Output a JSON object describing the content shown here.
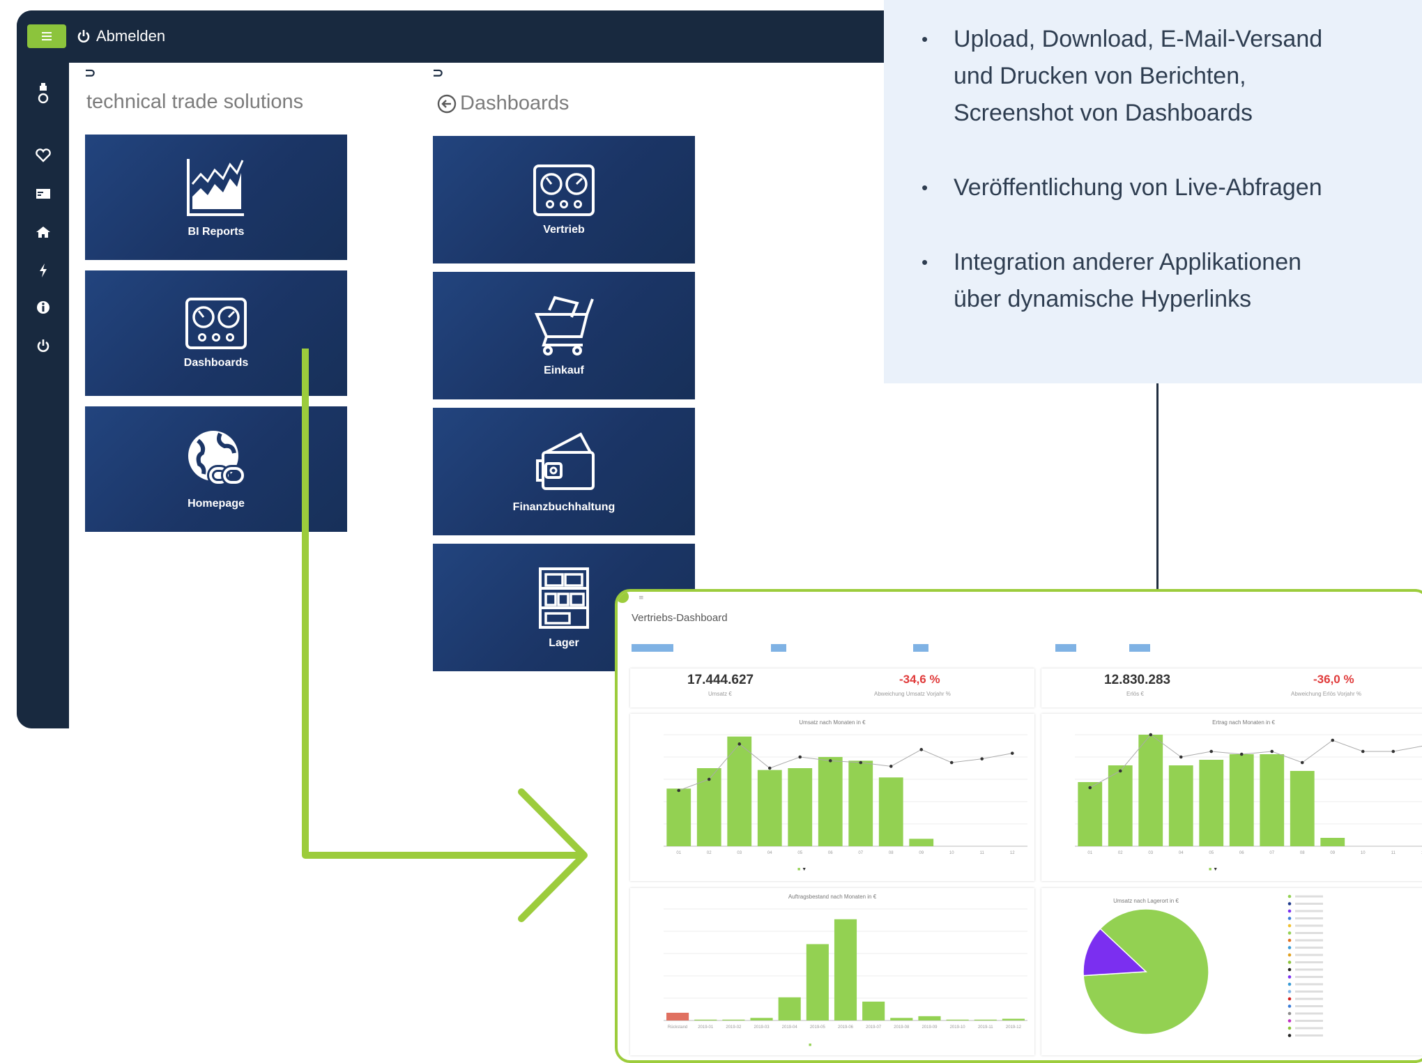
{
  "topbar": {
    "logout_label": "Abmelden"
  },
  "sidebar": {
    "icons": [
      "user-icon",
      "heart-icon",
      "card-icon",
      "home-icon",
      "bolt-icon",
      "info-icon",
      "power-icon"
    ]
  },
  "columns": [
    {
      "title": "technical trade solutions",
      "tiles": [
        "BI Reports",
        "Dashboards",
        "Homepage"
      ]
    },
    {
      "title": "Dashboards",
      "tiles": [
        "Vertrieb",
        "Einkauf",
        "Finanzbuchhaltung",
        "Lager"
      ]
    }
  ],
  "info": {
    "items": [
      {
        "lines": [
          "Upload, Download, E-Mail-Versand",
          "und Drucken von Berichten,",
          "Screenshot von Dashboards"
        ]
      },
      {
        "lines": [
          "Veröffentlichung von Live-Abfragen"
        ]
      },
      {
        "lines": [
          "Integration anderer Applikationen",
          "über dynamische Hyperlinks"
        ]
      }
    ]
  },
  "colors": {
    "navy": "#18293f",
    "accent_green": "#8cc43c",
    "tile_blue": "#1b3566",
    "bar_green": "#93d152",
    "negative": "#e03a3a",
    "pie_purple": "#7b2ff0"
  },
  "dashboard": {
    "title": "Vertriebs-Dashboard",
    "kpis": [
      {
        "value": "17.444.627",
        "label": "Umsatz €"
      },
      {
        "value": "-34,6 %",
        "label": "Abweichung Umsatz Vorjahr %"
      },
      {
        "value": "12.830.283",
        "label": "Erlös €"
      },
      {
        "value": "-36,0 %",
        "label": "Abweichung Erlös Vorjahr %"
      }
    ],
    "charts": [
      {
        "title": "Umsatz nach Monaten in €"
      },
      {
        "title": "Ertrag nach Monaten in €"
      },
      {
        "title": "Auftragsbestand nach Monaten in €"
      },
      {
        "title": "Umsatz nach Lagerort in €"
      }
    ]
  },
  "chart_data": [
    {
      "type": "bar",
      "title": "Umsatz nach Monaten in €",
      "categories": [
        "01",
        "02",
        "03",
        "04",
        "05",
        "06",
        "07",
        "08",
        "09",
        "10",
        "11",
        "12"
      ],
      "series": [
        {
          "values": [
            1550000,
            2100000,
            2950000,
            2050000,
            2100000,
            2400000,
            2300000,
            1850000,
            200000,
            0,
            0,
            0
          ]
        },
        {
          "values": [
            1500000,
            1800000,
            2750000,
            2100000,
            2400000,
            2300000,
            2250000,
            2150000,
            2600000,
            2250000,
            2350000,
            2500000
          ]
        }
      ],
      "ylim": [
        0,
        3000000
      ]
    },
    {
      "type": "bar",
      "title": "Ertrag nach Monaten in €",
      "categories": [
        "01",
        "02",
        "03",
        "04",
        "05",
        "06",
        "07",
        "08",
        "09",
        "10",
        "11",
        "12"
      ],
      "series": [
        {
          "values": [
            1150000,
            1450000,
            2000000,
            1450000,
            1550000,
            1650000,
            1650000,
            1350000,
            150000,
            0,
            0,
            0
          ]
        },
        {
          "values": [
            1050000,
            1350000,
            2000000,
            1600000,
            1700000,
            1650000,
            1700000,
            1500000,
            1900000,
            1700000,
            1700000,
            1800000
          ]
        }
      ],
      "ylim": [
        0,
        2000000
      ]
    },
    {
      "type": "bar",
      "title": "Auftragsbestand nach Monaten in €",
      "categories": [
        "Rückstand",
        "2019-01",
        "2019-02",
        "2019-03",
        "2019-04",
        "2019-05",
        "2019-06",
        "2019-07",
        "2019-08",
        "2019-09",
        "2019-10",
        "2019-11",
        "2019-12"
      ],
      "values": [
        90000,
        10000,
        10000,
        30000,
        270000,
        890000,
        1180000,
        220000,
        30000,
        50000,
        10000,
        10000,
        20000
      ],
      "ylim": [
        0,
        1300000
      ]
    },
    {
      "type": "pie",
      "title": "Umsatz nach Lagerort in €",
      "values": [
        87,
        13
      ]
    }
  ]
}
